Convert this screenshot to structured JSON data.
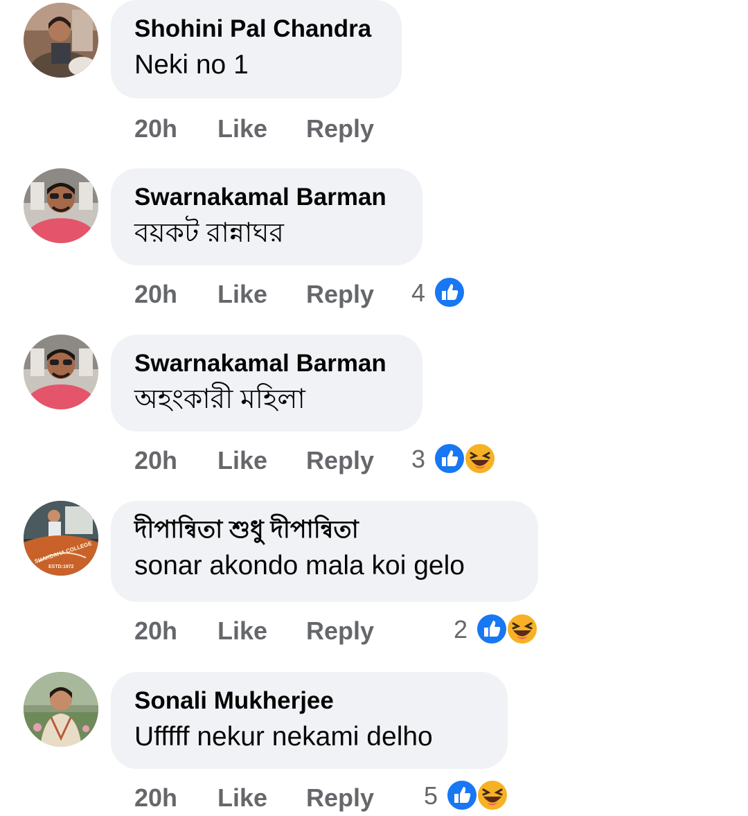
{
  "comments": [
    {
      "author": "Shohini Pal Chandra",
      "text": "Neki no 1",
      "time": "20h",
      "like_label": "Like",
      "reply_label": "Reply",
      "reaction_count": "",
      "reactions": []
    },
    {
      "author": "Swarnakamal Barman",
      "text": "বয়কট রান্নাঘর",
      "time": "20h",
      "like_label": "Like",
      "reply_label": "Reply",
      "reaction_count": "4",
      "reactions": [
        "like-icon"
      ]
    },
    {
      "author": "Swarnakamal Barman",
      "text": "অহংকারী মহিলা",
      "time": "20h",
      "like_label": "Like",
      "reply_label": "Reply",
      "reaction_count": "3",
      "reactions": [
        "like-icon",
        "haha-icon"
      ]
    },
    {
      "author": "দীপান্বিতা শুধু দীপান্বিতা",
      "text": "sonar akondo mala koi gelo",
      "time": "20h",
      "like_label": "Like",
      "reply_label": "Reply",
      "reaction_count": "2",
      "reactions": [
        "like-icon",
        "haha-icon"
      ],
      "avatar_badge_text": "SHAKDAHA COLLEGE",
      "avatar_badge_subtext": "ESTD:1972"
    },
    {
      "author": "Sonali Mukherjee",
      "text": "Ufffff nekur nekami delho",
      "time": "20h",
      "like_label": "Like",
      "reply_label": "Reply",
      "reaction_count": "5",
      "reactions": [
        "like-icon",
        "haha-icon"
      ]
    }
  ],
  "colors": {
    "bubble_bg": "#f0f2f5",
    "meta_text": "#65676b",
    "like_blue": "#1877f2",
    "haha_yellow": "#f7b125"
  }
}
